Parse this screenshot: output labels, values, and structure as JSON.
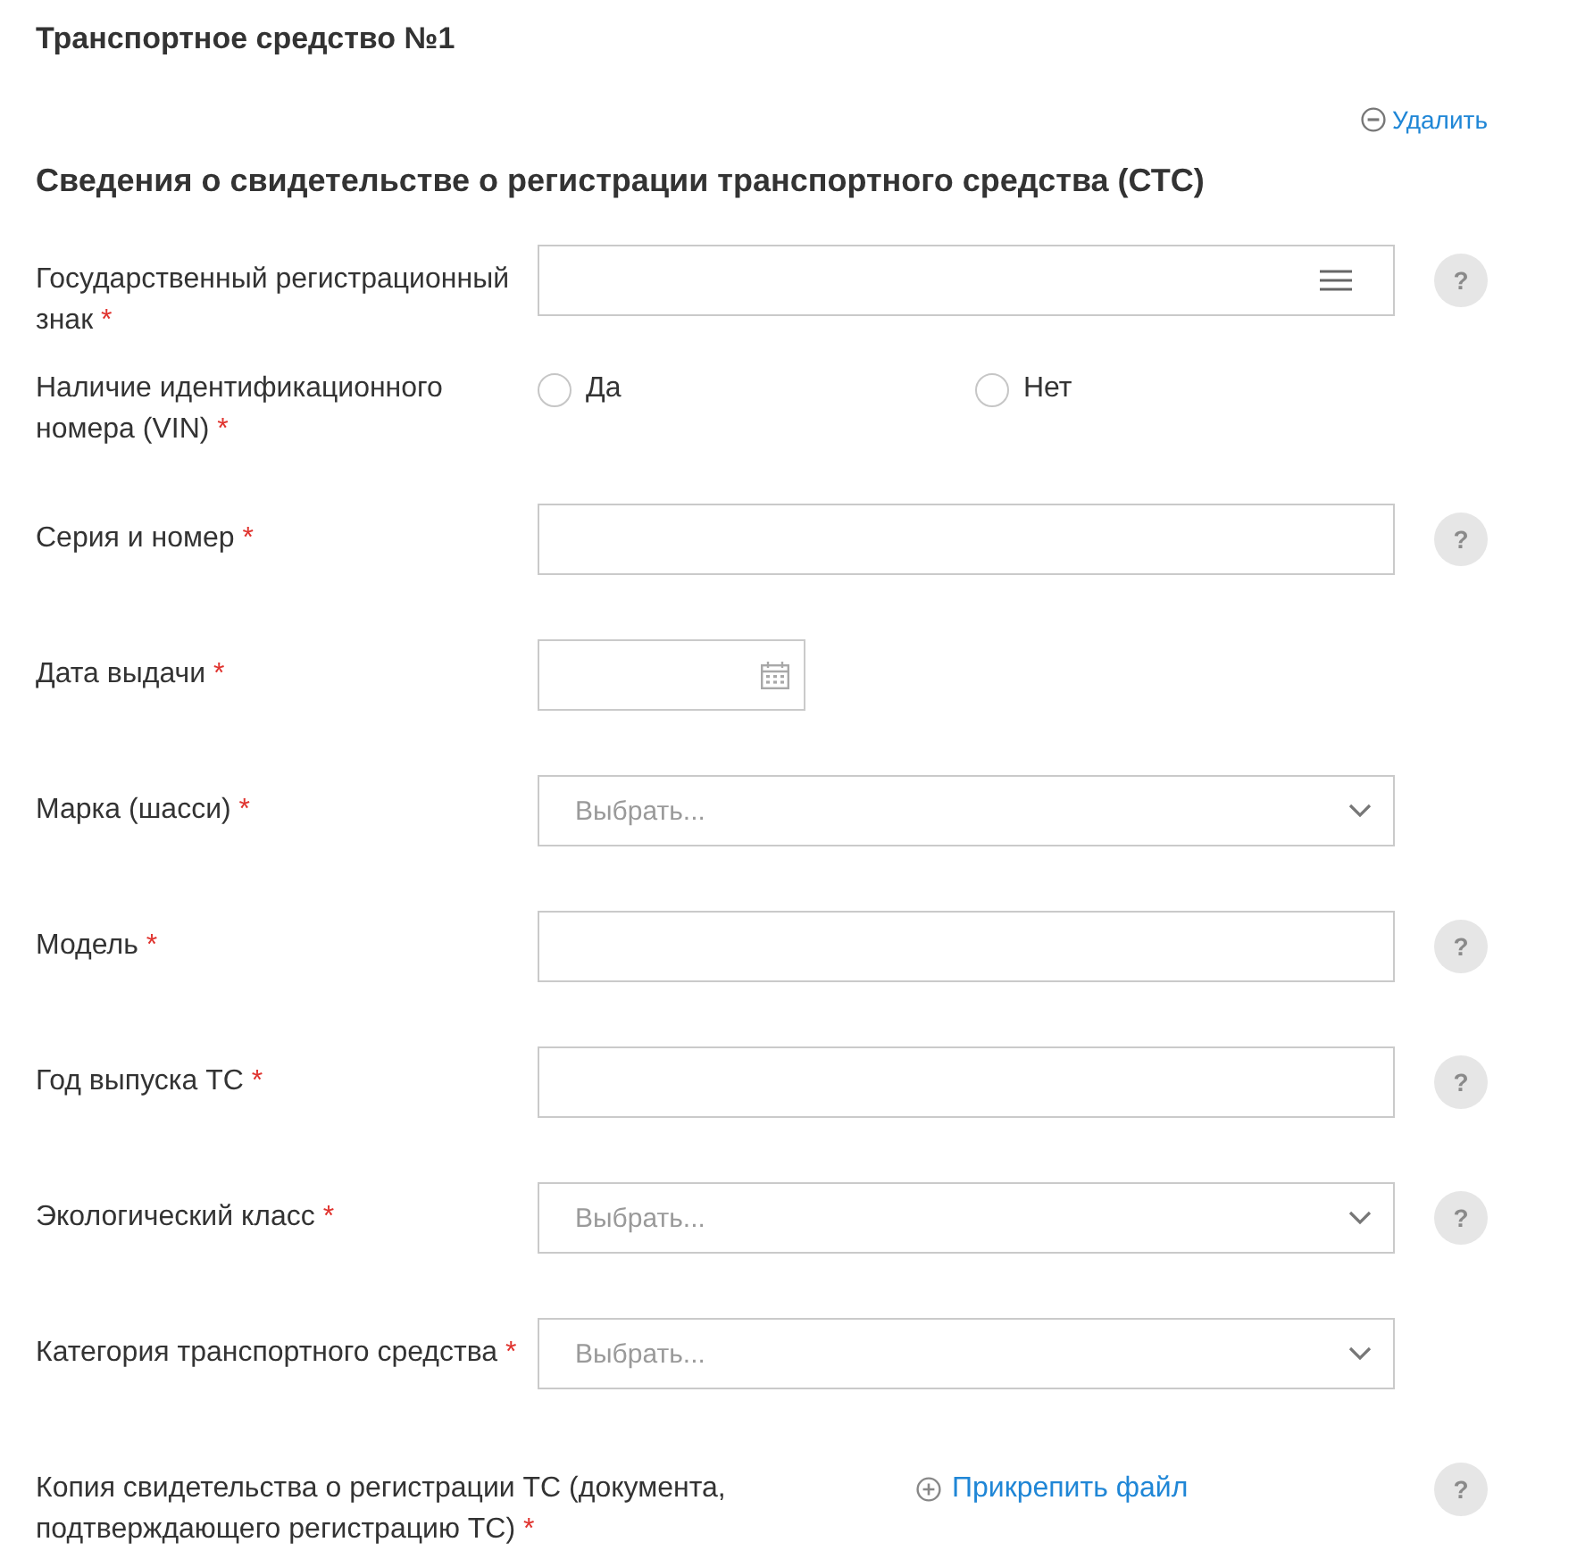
{
  "title": "Транспортное средство №1",
  "delete_link": "Удалить",
  "section": {
    "heading": "Сведения о свидетельстве о регистрации транспортного средства (СТС)",
    "rows": [
      {
        "kind": "lookup",
        "label": "Государственный регистрационный знак",
        "mark": "*",
        "help": "?"
      },
      {
        "kind": "radio",
        "label": "Наличие идентификационного номера (VIN)",
        "mark": "*",
        "options": [
          {
            "label": "Да",
            "selected": false
          },
          {
            "label": "Нет",
            "selected": false
          }
        ]
      },
      {
        "kind": "input",
        "label": "Серия и номер",
        "mark": "*",
        "help": "?"
      },
      {
        "kind": "date",
        "label": "Дата выдачи",
        "mark": "*"
      },
      {
        "kind": "select",
        "label": "Марка (шасси)",
        "mark": "*",
        "placeholder": "Выбрать..."
      },
      {
        "kind": "input",
        "label": "Модель",
        "mark": "*",
        "help": "?"
      },
      {
        "kind": "input",
        "label": "Год выпуска ТС",
        "mark": "*",
        "help": "?"
      },
      {
        "kind": "select",
        "label": "Экологический класс",
        "mark": "*",
        "placeholder": "Выбрать...",
        "help": "?"
      },
      {
        "kind": "select",
        "label": "Категория транспортного средства",
        "mark": "*",
        "placeholder": "Выбрать..."
      },
      {
        "kind": "file",
        "label": "Копия свидетельства о регистрации ТС (документа, подтверждающего регистрацию ТС)",
        "mark": "*",
        "link": "Прикрепить файл",
        "help": "?"
      }
    ]
  }
}
